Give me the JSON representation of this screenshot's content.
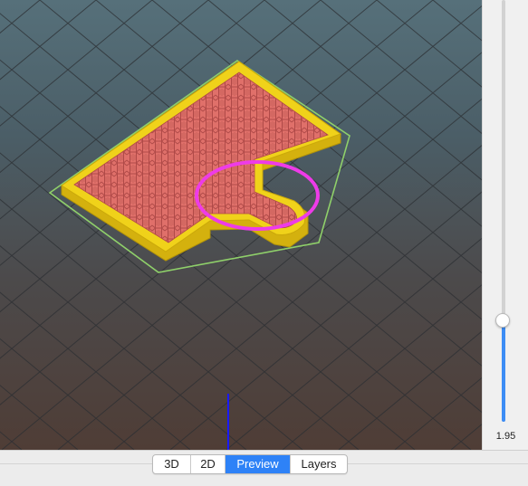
{
  "app": {
    "view_tabs": [
      {
        "label": "3D",
        "active": false
      },
      {
        "label": "2D",
        "active": false
      },
      {
        "label": "Preview",
        "active": true
      },
      {
        "label": "Layers",
        "active": false
      }
    ]
  },
  "layer_slider": {
    "value_label": "1.95",
    "level_fraction": 0.24
  },
  "colors": {
    "infill": "#e0706a",
    "perimeter": "#f0d21a",
    "skirt": "#8fd06a",
    "highlight_circle": "#ee3be8",
    "axis_line": "#1a1aff",
    "slider_accent": "#3d8df5"
  }
}
